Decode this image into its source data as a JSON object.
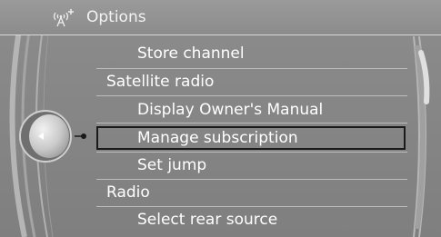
{
  "header": {
    "title": "Options",
    "icon": "satellite-radio-icon"
  },
  "menu": {
    "items": [
      {
        "label": "Store channel",
        "level": 2
      },
      {
        "label": "Satellite radio",
        "level": 1
      },
      {
        "label": "Display Owner's Manual",
        "level": 2
      },
      {
        "label": "Manage subscription",
        "level": 2,
        "selected": true
      },
      {
        "label": "Set jump",
        "level": 2
      },
      {
        "label": "Radio",
        "level": 1
      },
      {
        "label": "Select rear source",
        "level": 2
      }
    ]
  },
  "controller": {
    "icon": "left-arrow-icon"
  },
  "colors": {
    "background": "#888888",
    "text": "#ffffff",
    "selection_border": "#1a1a1a"
  }
}
